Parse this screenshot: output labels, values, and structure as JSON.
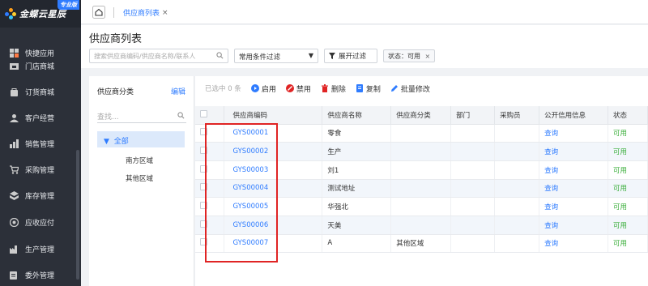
{
  "app": {
    "logo_text": "金蝶云星辰",
    "badge": "专业版"
  },
  "sidebar": {
    "items": [
      {
        "label": "快捷应用",
        "icon": "grid-icon"
      },
      {
        "label": "门店商城",
        "icon": "store-icon"
      },
      {
        "label": "订货商城",
        "icon": "bag-icon"
      },
      {
        "label": "客户经营",
        "icon": "customer-icon"
      },
      {
        "label": "销售管理",
        "icon": "sales-icon"
      },
      {
        "label": "采购管理",
        "icon": "cart-icon"
      },
      {
        "label": "库存管理",
        "icon": "inventory-icon"
      },
      {
        "label": "应收应付",
        "icon": "money-icon"
      },
      {
        "label": "生产管理",
        "icon": "factory-icon"
      },
      {
        "label": "委外管理",
        "icon": "outsource-icon"
      }
    ]
  },
  "tabs": [
    {
      "label": "供应商列表"
    }
  ],
  "page": {
    "title": "供应商列表",
    "search_placeholder": "搜索供应商编码/供应商名称/联系人",
    "filter_select": "常用条件过滤",
    "expand_filter": "展开过滤",
    "chip": "状态：可用"
  },
  "category": {
    "title": "供应商分类",
    "edit": "编辑",
    "search_placeholder": "查找...",
    "all": "全部",
    "children": [
      "南方区域",
      "其他区域"
    ]
  },
  "toolbar": {
    "selected": "已选中 0 条",
    "buttons": [
      "启用",
      "禁用",
      "删除",
      "复制",
      "批量修改"
    ]
  },
  "table": {
    "columns": [
      "供应商编码",
      "供应商名称",
      "供应商分类",
      "部门",
      "采购员",
      "公开信用信息",
      "状态"
    ],
    "rows": [
      {
        "code": "GYS00001",
        "name": "零食",
        "category": "",
        "dept": "",
        "buyer": "",
        "credit": "查询",
        "status": "可用"
      },
      {
        "code": "GYS00002",
        "name": "生产",
        "category": "",
        "dept": "",
        "buyer": "",
        "credit": "查询",
        "status": "可用"
      },
      {
        "code": "GYS00003",
        "name": "刘1",
        "category": "",
        "dept": "",
        "buyer": "",
        "credit": "查询",
        "status": "可用"
      },
      {
        "code": "GYS00004",
        "name": "测试地址",
        "category": "",
        "dept": "",
        "buyer": "",
        "credit": "查询",
        "status": "可用"
      },
      {
        "code": "GYS00005",
        "name": "华强北",
        "category": "",
        "dept": "",
        "buyer": "",
        "credit": "查询",
        "status": "可用"
      },
      {
        "code": "GYS00006",
        "name": "天美",
        "category": "",
        "dept": "",
        "buyer": "",
        "credit": "查询",
        "status": "可用"
      },
      {
        "code": "GYS00007",
        "name": "A",
        "category": "其他区域",
        "dept": "",
        "buyer": "",
        "credit": "查询",
        "status": "可用"
      }
    ]
  },
  "colors": {
    "accent": "#2f7cff",
    "sidebar": "#2c3039",
    "ok": "#3aae3a",
    "highlight": "#e02424"
  }
}
